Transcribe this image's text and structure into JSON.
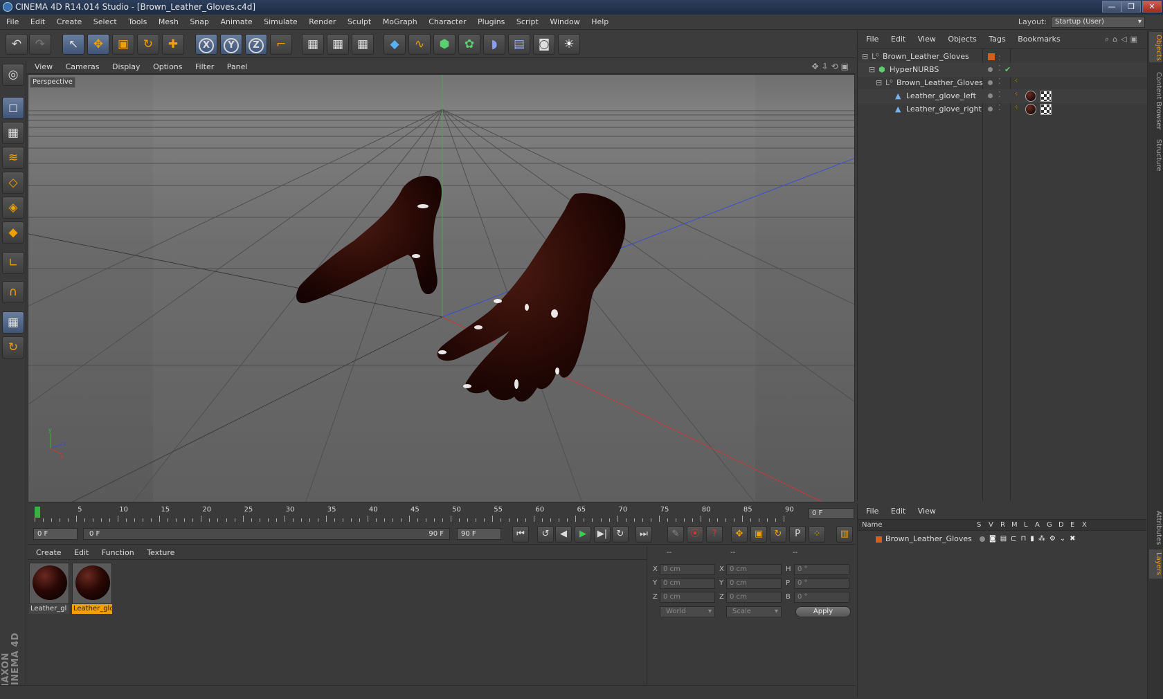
{
  "window": {
    "title": "CINEMA 4D R14.014 Studio - [Brown_Leather_Gloves.c4d]",
    "minimize": "—",
    "restore": "❐",
    "close": "✕"
  },
  "menubar": {
    "items": [
      "File",
      "Edit",
      "Create",
      "Select",
      "Tools",
      "Mesh",
      "Snap",
      "Animate",
      "Simulate",
      "Render",
      "Sculpt",
      "MoGraph",
      "Character",
      "Plugins",
      "Script",
      "Window",
      "Help"
    ],
    "layout_label": "Layout:",
    "layout_value": "Startup (User)"
  },
  "toolbar": {
    "undo": "↶",
    "redo": "↷",
    "select": "↖",
    "move": "✥",
    "scale": "▣",
    "rotate": "↻",
    "add": "✚",
    "x": "X",
    "y": "Y",
    "z": "Z",
    "coord": "⌐",
    "render_view": "▦",
    "render_pic": "▦",
    "render_settings": "▦",
    "cube": "◆",
    "spline": "∿",
    "nurbs": "⬢",
    "array": "✿",
    "deformer": "◗",
    "floor": "▤",
    "camera": "◙",
    "light": "☀"
  },
  "lefttools": [
    "◎",
    "◻",
    "▦",
    "≋",
    "◇",
    "◈",
    "◆",
    "∟",
    "∩",
    "▦",
    "↻"
  ],
  "maxon": "MAXON CINEMA 4D",
  "viewport": {
    "menu": [
      "View",
      "Cameras",
      "Display",
      "Options",
      "Filter",
      "Panel"
    ],
    "nav_icons": "✥⇩⟲▣",
    "label": "Perspective",
    "axis_y": "y",
    "axis_z": "z",
    "axis_x": "x"
  },
  "timeline": {
    "ticks": [
      "0",
      "5",
      "10",
      "15",
      "20",
      "25",
      "30",
      "35",
      "40",
      "45",
      "50",
      "55",
      "60",
      "65",
      "70",
      "75",
      "80",
      "85",
      "90"
    ],
    "current_frame": "0 F"
  },
  "transport": {
    "start": "0 F",
    "range_start": "0 F",
    "range_end": "90 F",
    "end": "90 F",
    "first": "⏮",
    "prev_key": "↺",
    "prev": "◀",
    "play": "▶",
    "next": "▶|",
    "next_key": "↻",
    "last": "⏭",
    "key_opts": [
      "✎",
      "⦿",
      "?"
    ],
    "key_mode": [
      "✥",
      "▣",
      "↻",
      "P",
      "⁘"
    ],
    "timeline_btn": "▥"
  },
  "materials": {
    "menu": [
      "Create",
      "Edit",
      "Function",
      "Texture"
    ],
    "items": [
      {
        "name": "Leather_gl",
        "selected": false
      },
      {
        "name": "Leather_glc",
        "selected": true
      }
    ]
  },
  "coords": {
    "headers": [
      "--",
      "--",
      "--"
    ],
    "rows": [
      {
        "a": "X",
        "av": "0 cm",
        "b": "X",
        "bv": "0 cm",
        "c": "H",
        "cv": "0 °"
      },
      {
        "a": "Y",
        "av": "0 cm",
        "b": "Y",
        "bv": "0 cm",
        "c": "P",
        "cv": "0 °"
      },
      {
        "a": "Z",
        "av": "0 cm",
        "b": "Z",
        "bv": "0 cm",
        "c": "B",
        "cv": "0 °"
      }
    ],
    "space": "World",
    "mode": "Scale",
    "apply": "Apply"
  },
  "objects": {
    "menu": [
      "File",
      "Edit",
      "View",
      "Objects",
      "Tags",
      "Bookmarks"
    ],
    "tree": [
      {
        "name": "Brown_Leather_Gloves",
        "type": "null"
      },
      {
        "name": "HyperNURBS",
        "type": "nurbs"
      },
      {
        "name": "Brown_Leather_Gloves",
        "type": "null"
      },
      {
        "name": "Leather_glove_left",
        "type": "mesh"
      },
      {
        "name": "Leather_glove_right",
        "type": "mesh"
      }
    ]
  },
  "layers": {
    "menu": [
      "File",
      "Edit",
      "View"
    ],
    "columns": [
      "Name",
      "S",
      "V",
      "R",
      "M",
      "L",
      "A",
      "G",
      "D",
      "E",
      "X"
    ],
    "rows": [
      {
        "name": "Brown_Leather_Gloves",
        "color": "#d0601c"
      }
    ]
  },
  "right_tabs": [
    "Objects",
    "Content Browser",
    "Structure",
    "Attributes",
    "Layers"
  ],
  "colors": {
    "accent": "#f0a000",
    "x_axis": "#c83a3a",
    "y_axis": "#3ab040",
    "z_axis": "#3a4ed0",
    "leather": "#2e0c08"
  }
}
